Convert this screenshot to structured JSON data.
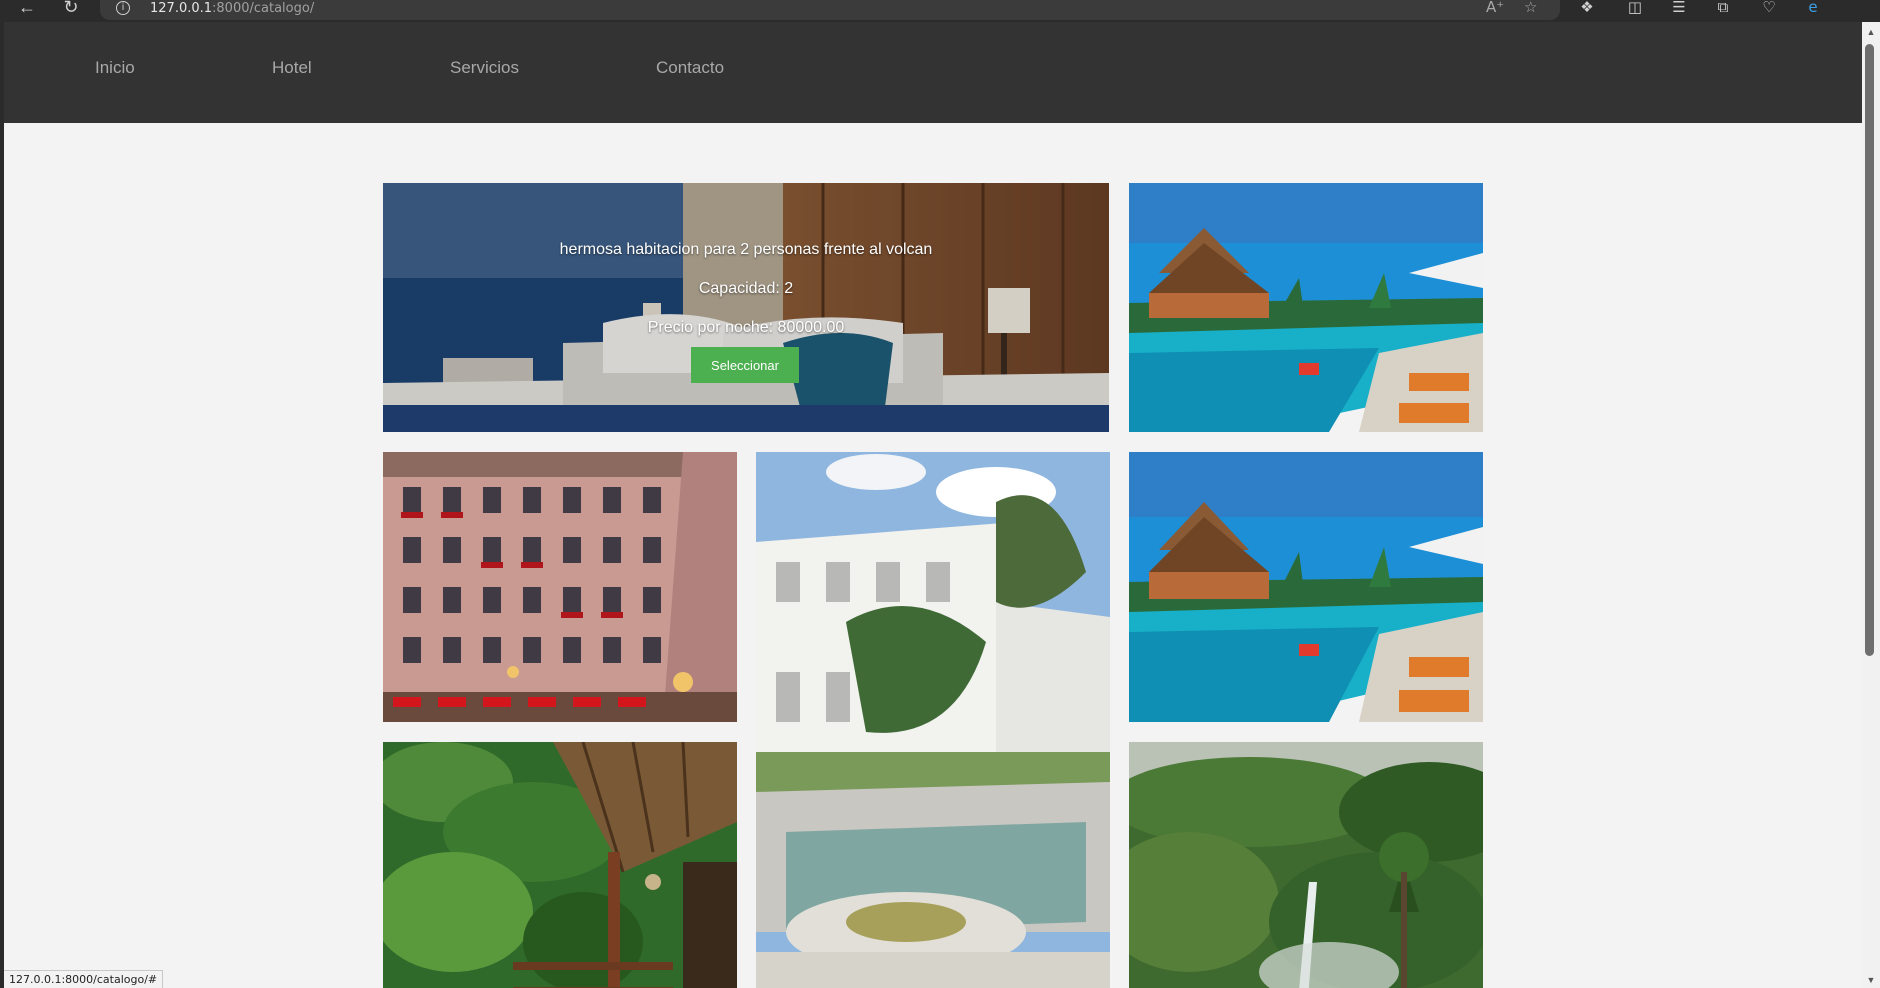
{
  "browser": {
    "url_host": "127.0.0.1",
    "url_rest": ":8000/catalogo/",
    "status_url": "127.0.0.1:8000/catalogo/#"
  },
  "nav": {
    "items": [
      {
        "label": "Inicio"
      },
      {
        "label": "Hotel"
      },
      {
        "label": "Servicios"
      },
      {
        "label": "Contacto"
      }
    ]
  },
  "featured": {
    "description": "hermosa habitacion para 2 personas frente al volcan",
    "capacity": "Capacidad: 2",
    "price": "Precio por noche: 80000.00",
    "button_label": "Seleccionar"
  },
  "gallery": {
    "images": [
      {
        "icon": "bedroom-ocean-view-photo"
      },
      {
        "icon": "tropical-pool-resort-photo"
      },
      {
        "icon": "classic-hotel-building-photo"
      },
      {
        "icon": "white-palace-garden-pool-photo"
      },
      {
        "icon": "tropical-pool-resort-photo"
      },
      {
        "icon": "rainforest-terrace-photo"
      },
      {
        "icon": "jungle-waterfall-photo"
      }
    ]
  },
  "colors": {
    "nav_background": "#333333",
    "page_background": "#f3f3f3",
    "button": "#4caf50"
  }
}
